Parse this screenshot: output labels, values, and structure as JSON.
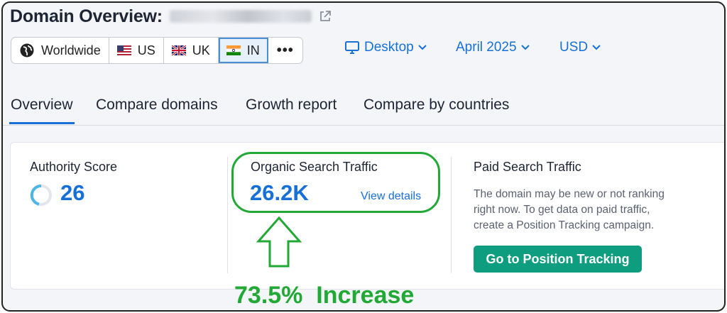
{
  "header": {
    "title": "Domain Overview:"
  },
  "regions": [
    {
      "label": "Worldwide",
      "icon": "globe-icon"
    },
    {
      "label": "US",
      "icon": "us-flag-icon"
    },
    {
      "label": "UK",
      "icon": "uk-flag-icon"
    },
    {
      "label": "IN",
      "icon": "india-flag-icon",
      "active": true
    }
  ],
  "more_label": "•••",
  "filters": {
    "device": "Desktop",
    "date": "April 2025",
    "currency": "USD"
  },
  "tabs": [
    "Overview",
    "Compare domains",
    "Growth report",
    "Compare by countries"
  ],
  "metrics": {
    "authority": {
      "label": "Authority Score",
      "value": "26"
    },
    "organic": {
      "label": "Organic Search Traffic",
      "value": "26.2K",
      "link": "View details"
    },
    "paid": {
      "label": "Paid Search Traffic",
      "description_lines": [
        "The domain may be new or not ranking",
        "right now. To get data on paid traffic,",
        "create a Position Tracking campaign."
      ],
      "button": "Go to Position Tracking"
    }
  },
  "annotation": {
    "text": "73.5%  Increase",
    "color": "#22a935"
  },
  "colors": {
    "accent": "#1670d8",
    "cta": "#0f9d80",
    "annotation": "#22a935"
  }
}
